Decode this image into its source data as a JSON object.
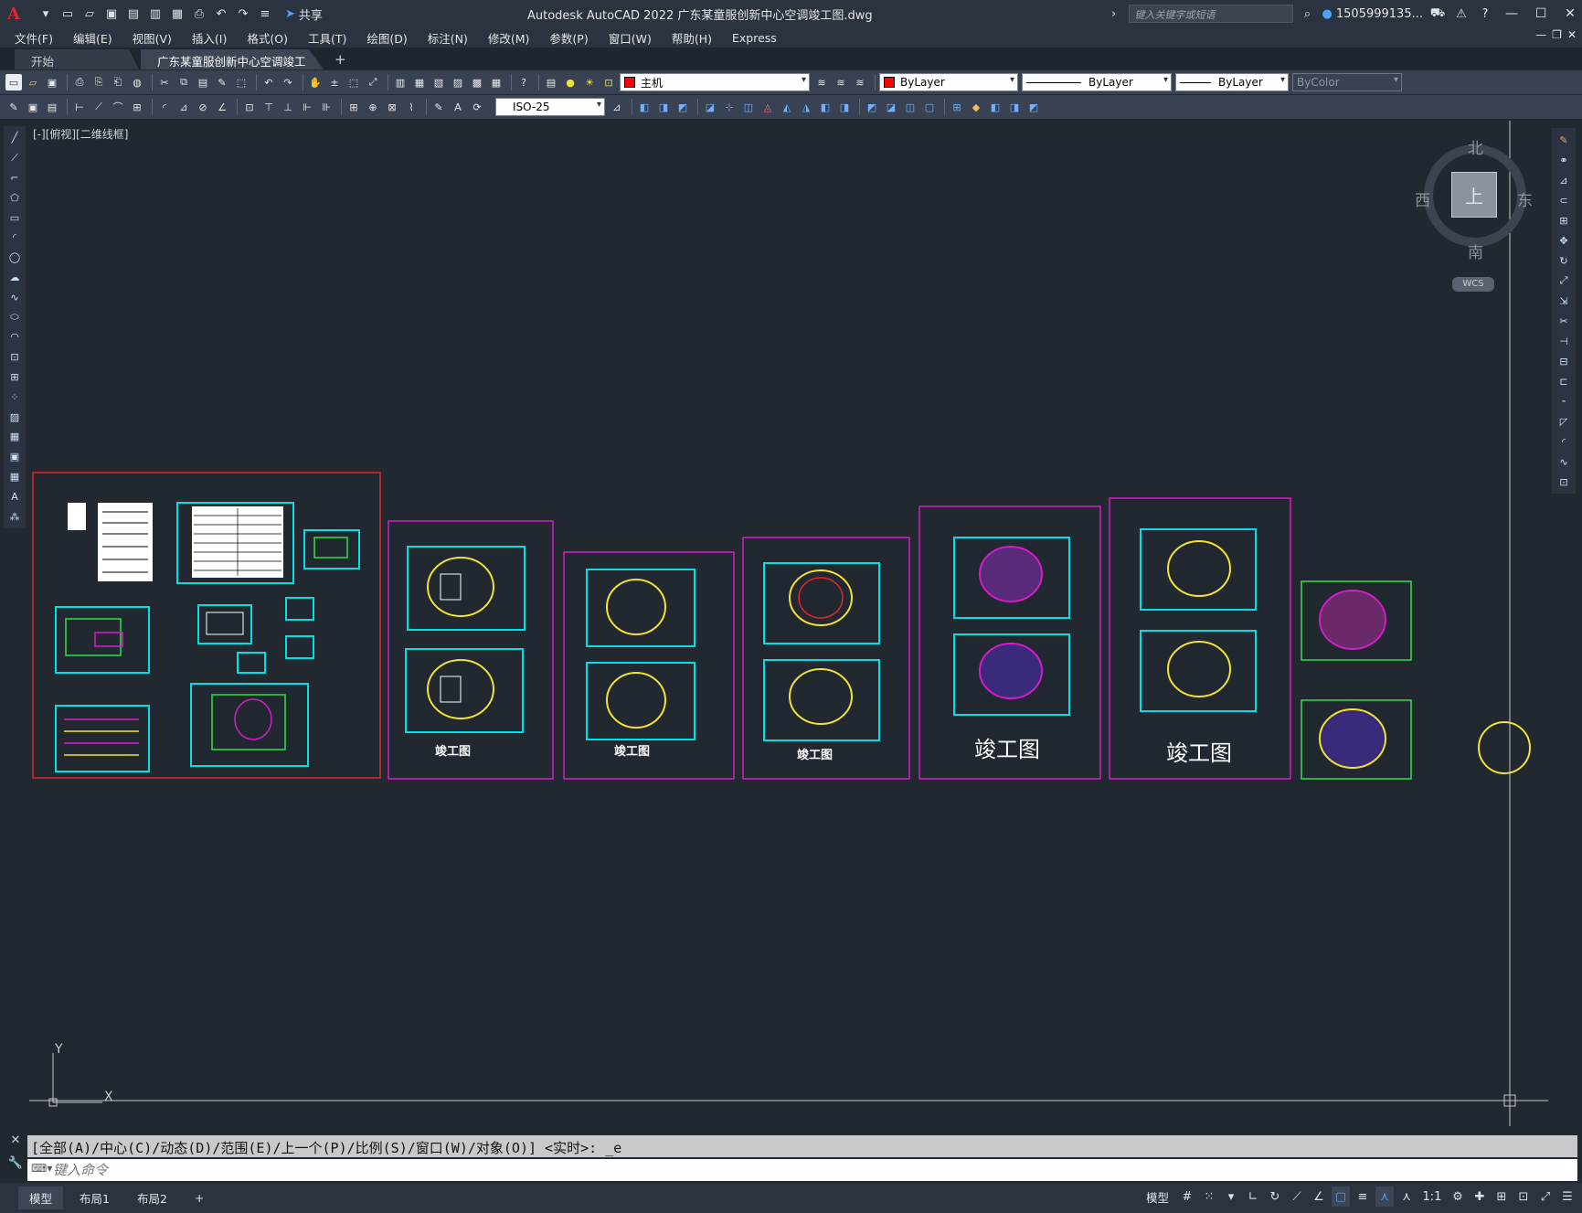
{
  "app": {
    "logo": "A",
    "title": "Autodesk AutoCAD 2022    广东某童服创新中心空调竣工图.dwg",
    "share_label": "共享",
    "search_placeholder": "键入关键字或短语",
    "user": "1505999135...",
    "help_icon": "?"
  },
  "menu": [
    "文件(F)",
    "编辑(E)",
    "视图(V)",
    "插入(I)",
    "格式(O)",
    "工具(T)",
    "绘图(D)",
    "标注(N)",
    "修改(M)",
    "参数(P)",
    "窗口(W)",
    "帮助(H)",
    "Express"
  ],
  "tabs": {
    "start": "开始",
    "drawing": "广东某童服创新中心空调竣工图*",
    "add": "+"
  },
  "toolbar1": {
    "layer": "主机",
    "color": "ByLayer",
    "linetype": "ByLayer",
    "lineweight": "ByLayer",
    "plotstyle": "ByColor"
  },
  "toolbar2": {
    "dimstyle": "ISO-25"
  },
  "viewport": {
    "label": "[-][俯视][二维线框]"
  },
  "viewcube": {
    "north": "北",
    "south": "南",
    "east": "东",
    "west": "西",
    "face": "上",
    "wcs": "WCS"
  },
  "drawing": {
    "sheet_labels": [
      "竣工图",
      "竣工图",
      "竣工图",
      "竣工图",
      "竣工图"
    ],
    "ucs_y": "Y",
    "ucs_x": "X"
  },
  "command": {
    "history": "[全部(A)/中心(C)/动态(D)/范围(E)/上一个(P)/比例(S)/窗口(W)/对象(O)] <实时>: _e",
    "placeholder": "键入命令"
  },
  "statusbar": {
    "layouts": [
      "模型",
      "布局1",
      "布局2"
    ],
    "add": "+",
    "model_label": "模型",
    "scale": "1:1"
  },
  "colors": {
    "background": "#212830",
    "red_frame": "#e0262b",
    "magenta_frame": "#d41cc8",
    "cyan_frame": "#00e0e8",
    "green_frame": "#2fe04a",
    "yellow": "#f2e233"
  }
}
